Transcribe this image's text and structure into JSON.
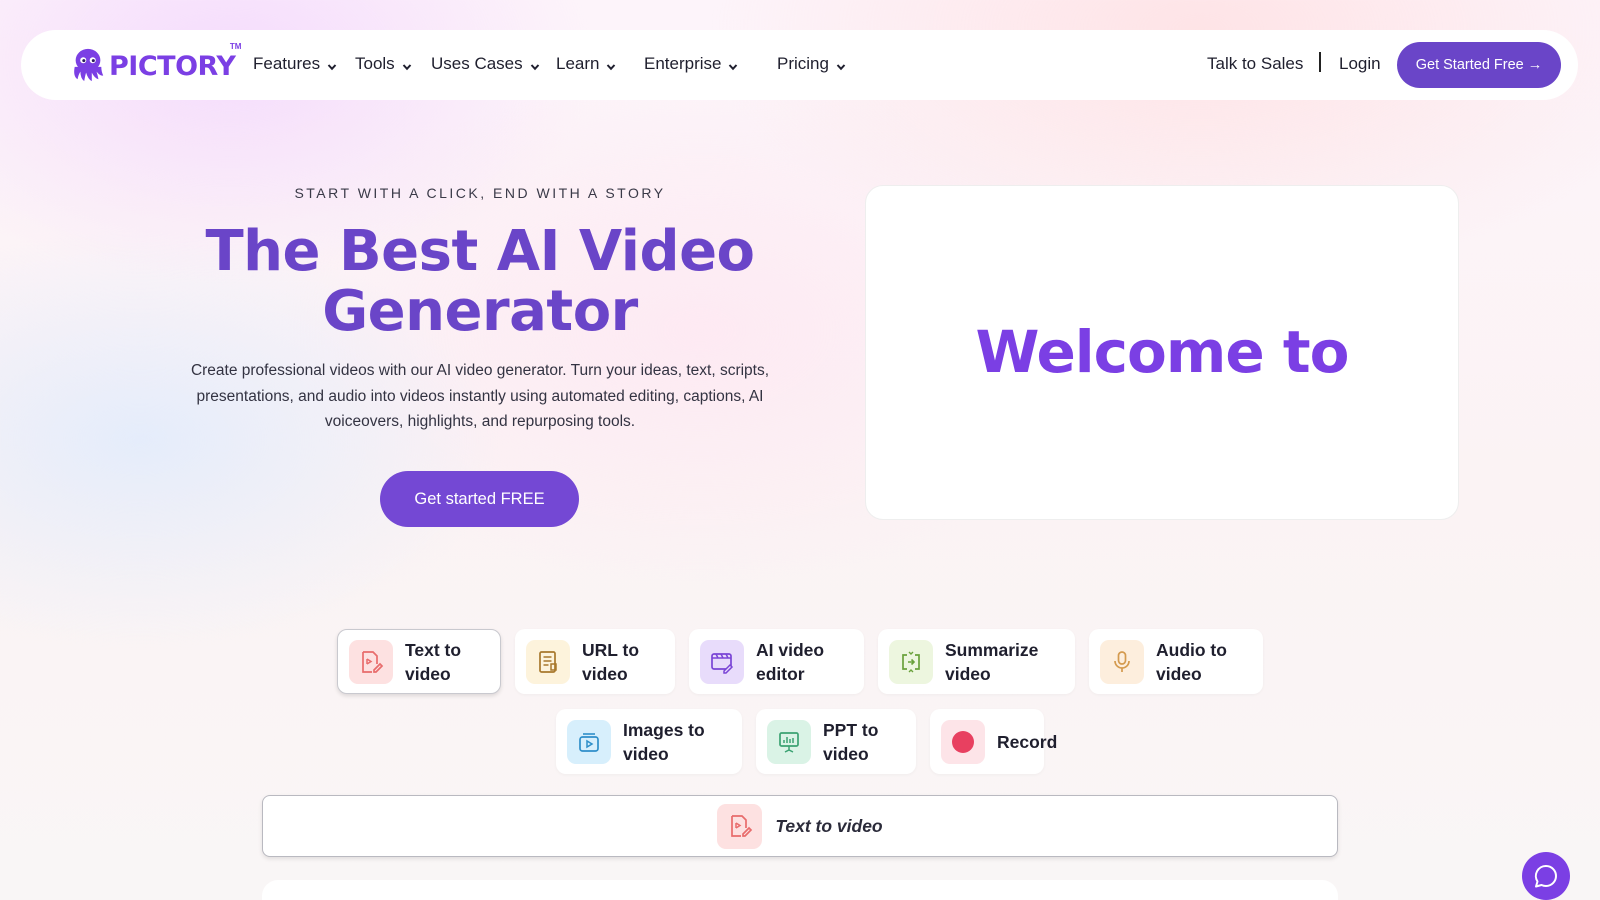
{
  "brand": {
    "name": "PICTORY",
    "tm": "TM",
    "color": "#7b3fe4"
  },
  "nav": {
    "items": [
      {
        "label": "Features"
      },
      {
        "label": "Tools"
      },
      {
        "label": "Uses Cases"
      },
      {
        "label": "Learn"
      },
      {
        "label": "Enterprise"
      },
      {
        "label": "Pricing"
      }
    ],
    "talk_to_sales": "Talk to Sales",
    "login": "Login",
    "cta": "Get Started Free →"
  },
  "hero": {
    "eyebrow": "START WITH A CLICK, END WITH A STORY",
    "title": "The Best AI Video Generator",
    "description": "Create professional videos with our AI video generator. Turn your ideas, text, scripts, presentations, and audio into videos instantly using automated editing, captions, AI voiceovers, highlights, and repurposing tools.",
    "cta": "Get started FREE",
    "preview_text": "Welcome to"
  },
  "tools": {
    "tabs": [
      {
        "label": "Text to\nvideo",
        "icon": "text-to-video-icon",
        "bg": "#fde1e1",
        "active": true
      },
      {
        "label": "URL to\nvideo",
        "icon": "url-to-video-icon",
        "bg": "#fdf3dc",
        "active": false
      },
      {
        "label": "AI video\neditor",
        "icon": "ai-video-editor-icon",
        "bg": "#e8dcfb",
        "active": false
      },
      {
        "label": "Summarize\nvideo",
        "icon": "summarize-video-icon",
        "bg": "#edf6df",
        "active": false
      },
      {
        "label": "Audio to\nvideo",
        "icon": "audio-to-video-icon",
        "bg": "#fdeedd",
        "active": false
      },
      {
        "label": "Images to\nvideo",
        "icon": "images-to-video-icon",
        "bg": "#d7effc",
        "active": false
      },
      {
        "label": "PPT to\nvideo",
        "icon": "ppt-to-video-icon",
        "bg": "#daf3e6",
        "active": false
      },
      {
        "label": "Record",
        "icon": "record-icon",
        "bg": "#fde4e8",
        "active": false
      }
    ],
    "selected_label": "Text to video"
  },
  "colors": {
    "accent": "#6a45c8",
    "accent_cta": "#7448d4"
  }
}
